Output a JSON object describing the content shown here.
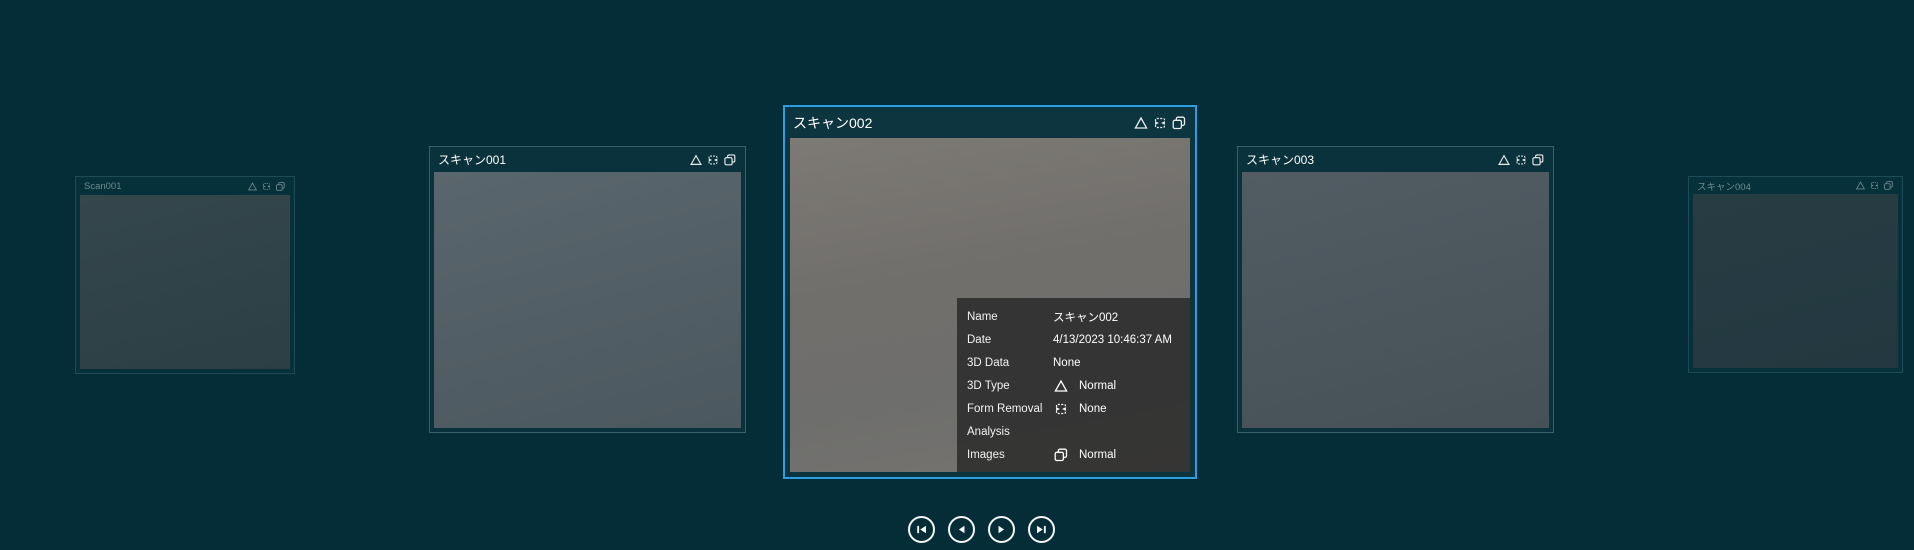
{
  "app": {
    "background_color": "#042d37",
    "accent_color": "#2d9ee0"
  },
  "carousel": {
    "cards": [
      {
        "title": "Scan001",
        "state": "dimmed"
      },
      {
        "title": "スキャン001",
        "state": "normal"
      },
      {
        "title": "スキャン002",
        "state": "selected"
      },
      {
        "title": "スキャン003",
        "state": "normal"
      },
      {
        "title": "スキャン004",
        "state": "dimmed"
      }
    ],
    "header_icons": [
      {
        "name": "3d-type-icon",
        "glyph": "triangle-outline"
      },
      {
        "name": "form-removal-icon",
        "glyph": "dashed-split-rect"
      },
      {
        "name": "images-icon",
        "glyph": "overlapping-squares"
      }
    ]
  },
  "info_panel": {
    "rows": [
      {
        "label": "Name",
        "value": "スキャン002"
      },
      {
        "label": "Date",
        "value": "4/13/2023 10:46:37 AM"
      },
      {
        "label": "3D Data",
        "value": "None"
      },
      {
        "label": "3D Type",
        "value": "Normal",
        "icon": "triangle-outline"
      },
      {
        "label": "Form Removal",
        "value": "None",
        "icon": "dashed-split-rect"
      },
      {
        "label": "Analysis",
        "value": ""
      },
      {
        "label": "Images",
        "value": "Normal",
        "icon": "overlapping-squares"
      }
    ]
  },
  "navigation": {
    "buttons": [
      {
        "name": "first",
        "icon": "skip-to-first"
      },
      {
        "name": "previous",
        "icon": "previous"
      },
      {
        "name": "next",
        "icon": "next"
      },
      {
        "name": "last",
        "icon": "skip-to-last"
      }
    ]
  }
}
